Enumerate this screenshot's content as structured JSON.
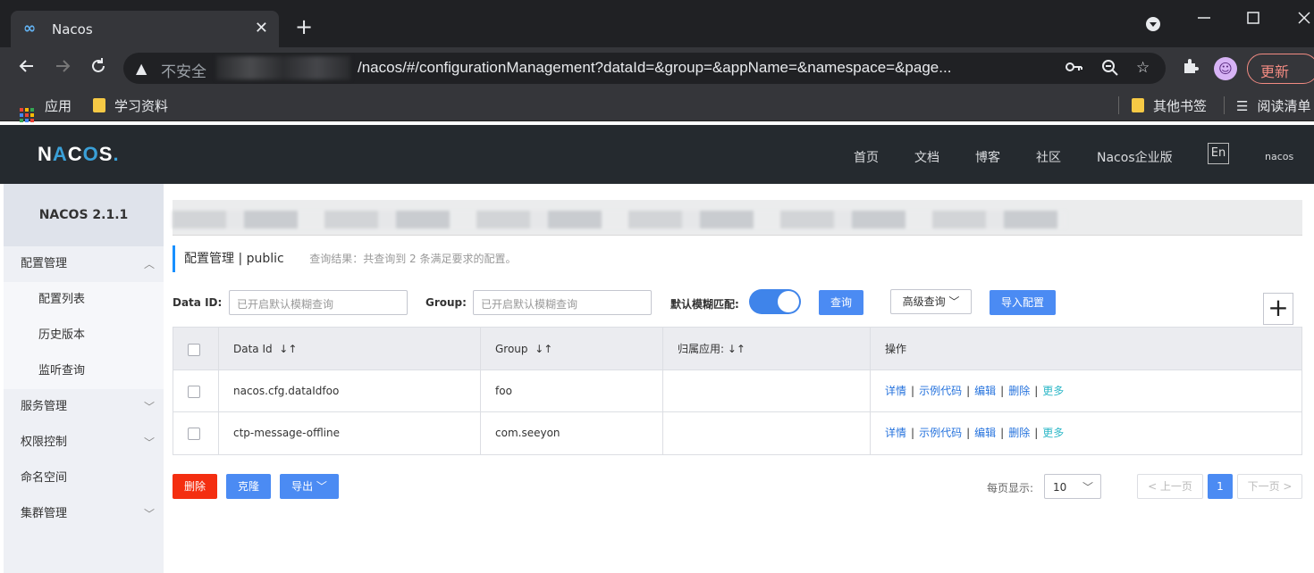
{
  "browser": {
    "tab_logo": "∞",
    "tab_title": "Nacos",
    "tab_close": "✕",
    "new_tab": "+",
    "insecure_label": "不安全",
    "url": "/nacos/#/configurationManagement?dataId=&group=&appName=&namespace=&page...",
    "update_button": "更新",
    "bookmarks": {
      "apps": "应用",
      "study": "学习资料",
      "other": "其他书签",
      "reading_list": "阅读清单"
    }
  },
  "nav": {
    "brand": "NACOS",
    "links": [
      "首页",
      "文档",
      "博客",
      "社区",
      "Nacos企业版"
    ],
    "lang": "En",
    "user": "nacos"
  },
  "sidebar": {
    "version": "NACOS 2.1.1",
    "items": [
      {
        "label": "配置管理"
      },
      {
        "label": "配置列表"
      },
      {
        "label": "历史版本"
      },
      {
        "label": "监听查询"
      },
      {
        "label": "服务管理"
      },
      {
        "label": "权限控制"
      },
      {
        "label": "命名空间"
      },
      {
        "label": "集群管理"
      }
    ]
  },
  "main": {
    "breadcrumb": "配置管理 | public",
    "result": "查询结果：共查询到 2 条满足要求的配置。",
    "search": {
      "dataid_label": "Data ID:",
      "dataid_placeholder": "已开启默认模糊查询",
      "group_label": "Group:",
      "group_placeholder": "已开启默认模糊查询",
      "fuzzy_label": "默认模糊匹配:",
      "query_button": "查询",
      "advanced_button": "高级查询",
      "import_button": "导入配置",
      "add_button": "+"
    },
    "table": {
      "headers": [
        "Data Id",
        "Group",
        "归属应用:",
        "操作"
      ],
      "sort_icon": "↓↑",
      "rows": [
        {
          "data_id": "nacos.cfg.dataIdfoo",
          "group": "foo",
          "app": ""
        },
        {
          "data_id": "ctp-message-offline",
          "group": "com.seeyon",
          "app": ""
        }
      ],
      "actions": {
        "detail": "详情",
        "sample": "示例代码",
        "edit": "编辑",
        "delete": "删除",
        "more": "更多",
        "sep": "|"
      }
    },
    "bottom": {
      "delete": "删除",
      "clone": "克隆",
      "export": "导出",
      "page_size_label": "每页显示:",
      "page_size": "10",
      "prev": "< 上一页",
      "current_page": "1",
      "next": "下一页 >"
    }
  },
  "colors": {
    "accent": "#4b8bf3",
    "danger": "#f42e10",
    "nav_bg": "#252a2f"
  }
}
